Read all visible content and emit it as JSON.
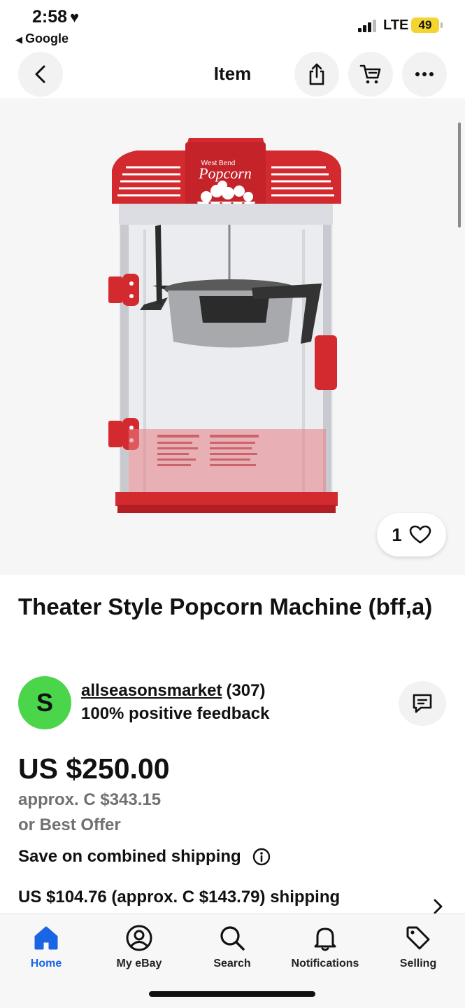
{
  "status_bar": {
    "time": "2:58",
    "back_app": "Google",
    "network": "LTE",
    "battery": "49"
  },
  "nav": {
    "title": "Item",
    "icons": [
      "back-chevron-icon",
      "share-icon",
      "cart-icon",
      "more-icon"
    ]
  },
  "product_image": {
    "brand_text": "West Bend",
    "logo_text": "Popcorn",
    "watch_count": "1"
  },
  "listing": {
    "title": "Theater Style Popcorn Machine (bff,a)",
    "seller": {
      "avatar_letter": "S",
      "name": "allseasonsmarket",
      "count": "(307)",
      "feedback": "100% positive feedback"
    },
    "price": "US $250.00",
    "approx": "approx. C $343.15",
    "offer": "or Best Offer",
    "combined_shipping": "Save on combined shipping",
    "shipping": "US $104.76 (approx. C $143.79) shipping"
  },
  "tabbar": {
    "items": [
      {
        "label": "Home",
        "icon": "home-icon",
        "active": true
      },
      {
        "label": "My eBay",
        "icon": "user-icon",
        "active": false
      },
      {
        "label": "Search",
        "icon": "search-icon",
        "active": false
      },
      {
        "label": "Notifications",
        "icon": "bell-icon",
        "active": false
      },
      {
        "label": "Selling",
        "icon": "tag-icon",
        "active": false
      }
    ]
  },
  "colors": {
    "accent": "#1a64e6",
    "avatar": "#4bd54b",
    "machine_red": "#d32a2f",
    "battery": "#f4d530"
  }
}
